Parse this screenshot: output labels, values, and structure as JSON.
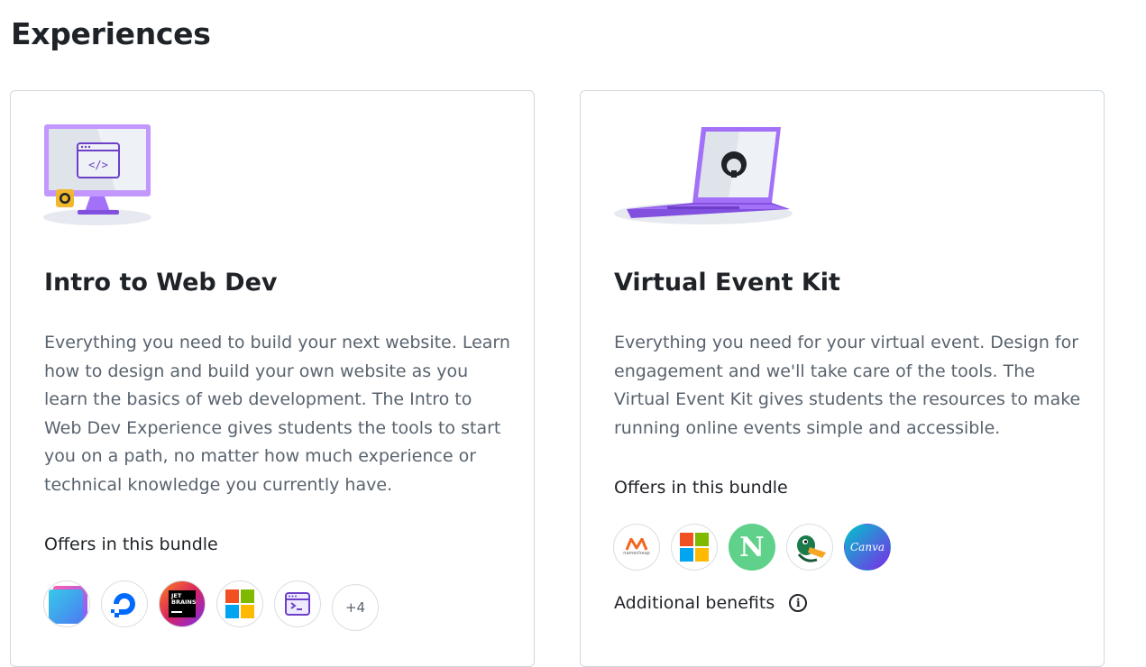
{
  "page": {
    "title": "Experiences"
  },
  "cards": [
    {
      "title": "Intro to Web Dev",
      "description": "Everything you need to build your next website. Learn how to design and build your own website as you learn the basics of web development. The Intro to Web Dev Experience gives students the tools to start you on a path, no matter how much experience or technical knowledge you currently have.",
      "offers_label": "Offers in this bundle",
      "offer_logos": [
        "stacked-squares-logo",
        "digitalocean-logo",
        "jetbrains-logo",
        "microsoft-logo",
        "terminal-window-logo"
      ],
      "more_count": "+4"
    },
    {
      "title": "Virtual Event Kit",
      "description": "Everything you need for your virtual event. Design for engagement and we'll take care of the tools. The Virtual Event Kit gives students the resources to make running online events simple and accessible.",
      "offers_label": "Offers in this bundle",
      "offer_logos": [
        "namecheap-logo",
        "microsoft-logo",
        "notion-n-logo",
        "duck-logo",
        "canva-logo"
      ],
      "namecheap_caption": "namecheap",
      "jetbrains_text": "JET BRAINS",
      "canva_text": "Canva",
      "notion_text": "N",
      "additional_benefits_label": "Additional benefits"
    }
  ],
  "colors": {
    "accent_purple": "#a371f7",
    "text_muted": "#59636e",
    "border": "#d0d7de"
  }
}
